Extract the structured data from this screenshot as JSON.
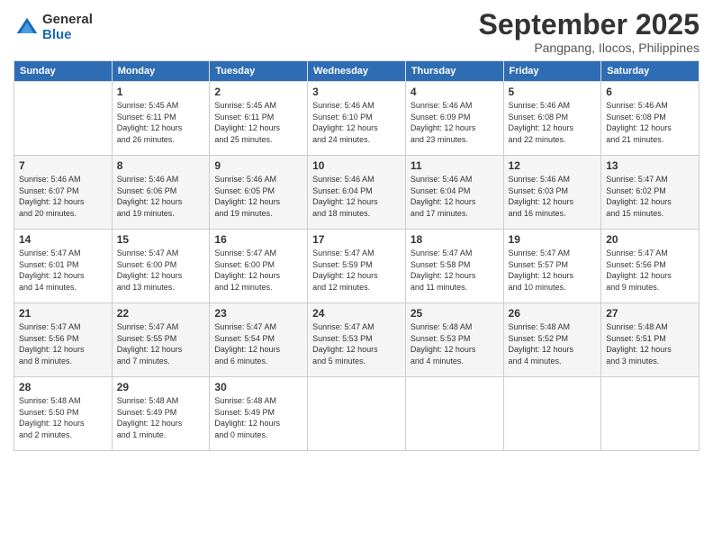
{
  "logo": {
    "general": "General",
    "blue": "Blue"
  },
  "header": {
    "month": "September 2025",
    "location": "Pangpang, Ilocos, Philippines"
  },
  "weekdays": [
    "Sunday",
    "Monday",
    "Tuesday",
    "Wednesday",
    "Thursday",
    "Friday",
    "Saturday"
  ],
  "weeks": [
    [
      {
        "day": "",
        "info": ""
      },
      {
        "day": "1",
        "info": "Sunrise: 5:45 AM\nSunset: 6:11 PM\nDaylight: 12 hours\nand 26 minutes."
      },
      {
        "day": "2",
        "info": "Sunrise: 5:45 AM\nSunset: 6:11 PM\nDaylight: 12 hours\nand 25 minutes."
      },
      {
        "day": "3",
        "info": "Sunrise: 5:46 AM\nSunset: 6:10 PM\nDaylight: 12 hours\nand 24 minutes."
      },
      {
        "day": "4",
        "info": "Sunrise: 5:46 AM\nSunset: 6:09 PM\nDaylight: 12 hours\nand 23 minutes."
      },
      {
        "day": "5",
        "info": "Sunrise: 5:46 AM\nSunset: 6:08 PM\nDaylight: 12 hours\nand 22 minutes."
      },
      {
        "day": "6",
        "info": "Sunrise: 5:46 AM\nSunset: 6:08 PM\nDaylight: 12 hours\nand 21 minutes."
      }
    ],
    [
      {
        "day": "7",
        "info": "Sunrise: 5:46 AM\nSunset: 6:07 PM\nDaylight: 12 hours\nand 20 minutes."
      },
      {
        "day": "8",
        "info": "Sunrise: 5:46 AM\nSunset: 6:06 PM\nDaylight: 12 hours\nand 19 minutes."
      },
      {
        "day": "9",
        "info": "Sunrise: 5:46 AM\nSunset: 6:05 PM\nDaylight: 12 hours\nand 19 minutes."
      },
      {
        "day": "10",
        "info": "Sunrise: 5:46 AM\nSunset: 6:04 PM\nDaylight: 12 hours\nand 18 minutes."
      },
      {
        "day": "11",
        "info": "Sunrise: 5:46 AM\nSunset: 6:04 PM\nDaylight: 12 hours\nand 17 minutes."
      },
      {
        "day": "12",
        "info": "Sunrise: 5:46 AM\nSunset: 6:03 PM\nDaylight: 12 hours\nand 16 minutes."
      },
      {
        "day": "13",
        "info": "Sunrise: 5:47 AM\nSunset: 6:02 PM\nDaylight: 12 hours\nand 15 minutes."
      }
    ],
    [
      {
        "day": "14",
        "info": "Sunrise: 5:47 AM\nSunset: 6:01 PM\nDaylight: 12 hours\nand 14 minutes."
      },
      {
        "day": "15",
        "info": "Sunrise: 5:47 AM\nSunset: 6:00 PM\nDaylight: 12 hours\nand 13 minutes."
      },
      {
        "day": "16",
        "info": "Sunrise: 5:47 AM\nSunset: 6:00 PM\nDaylight: 12 hours\nand 12 minutes."
      },
      {
        "day": "17",
        "info": "Sunrise: 5:47 AM\nSunset: 5:59 PM\nDaylight: 12 hours\nand 12 minutes."
      },
      {
        "day": "18",
        "info": "Sunrise: 5:47 AM\nSunset: 5:58 PM\nDaylight: 12 hours\nand 11 minutes."
      },
      {
        "day": "19",
        "info": "Sunrise: 5:47 AM\nSunset: 5:57 PM\nDaylight: 12 hours\nand 10 minutes."
      },
      {
        "day": "20",
        "info": "Sunrise: 5:47 AM\nSunset: 5:56 PM\nDaylight: 12 hours\nand 9 minutes."
      }
    ],
    [
      {
        "day": "21",
        "info": "Sunrise: 5:47 AM\nSunset: 5:56 PM\nDaylight: 12 hours\nand 8 minutes."
      },
      {
        "day": "22",
        "info": "Sunrise: 5:47 AM\nSunset: 5:55 PM\nDaylight: 12 hours\nand 7 minutes."
      },
      {
        "day": "23",
        "info": "Sunrise: 5:47 AM\nSunset: 5:54 PM\nDaylight: 12 hours\nand 6 minutes."
      },
      {
        "day": "24",
        "info": "Sunrise: 5:47 AM\nSunset: 5:53 PM\nDaylight: 12 hours\nand 5 minutes."
      },
      {
        "day": "25",
        "info": "Sunrise: 5:48 AM\nSunset: 5:53 PM\nDaylight: 12 hours\nand 4 minutes."
      },
      {
        "day": "26",
        "info": "Sunrise: 5:48 AM\nSunset: 5:52 PM\nDaylight: 12 hours\nand 4 minutes."
      },
      {
        "day": "27",
        "info": "Sunrise: 5:48 AM\nSunset: 5:51 PM\nDaylight: 12 hours\nand 3 minutes."
      }
    ],
    [
      {
        "day": "28",
        "info": "Sunrise: 5:48 AM\nSunset: 5:50 PM\nDaylight: 12 hours\nand 2 minutes."
      },
      {
        "day": "29",
        "info": "Sunrise: 5:48 AM\nSunset: 5:49 PM\nDaylight: 12 hours\nand 1 minute."
      },
      {
        "day": "30",
        "info": "Sunrise: 5:48 AM\nSunset: 5:49 PM\nDaylight: 12 hours\nand 0 minutes."
      },
      {
        "day": "",
        "info": ""
      },
      {
        "day": "",
        "info": ""
      },
      {
        "day": "",
        "info": ""
      },
      {
        "day": "",
        "info": ""
      }
    ]
  ]
}
